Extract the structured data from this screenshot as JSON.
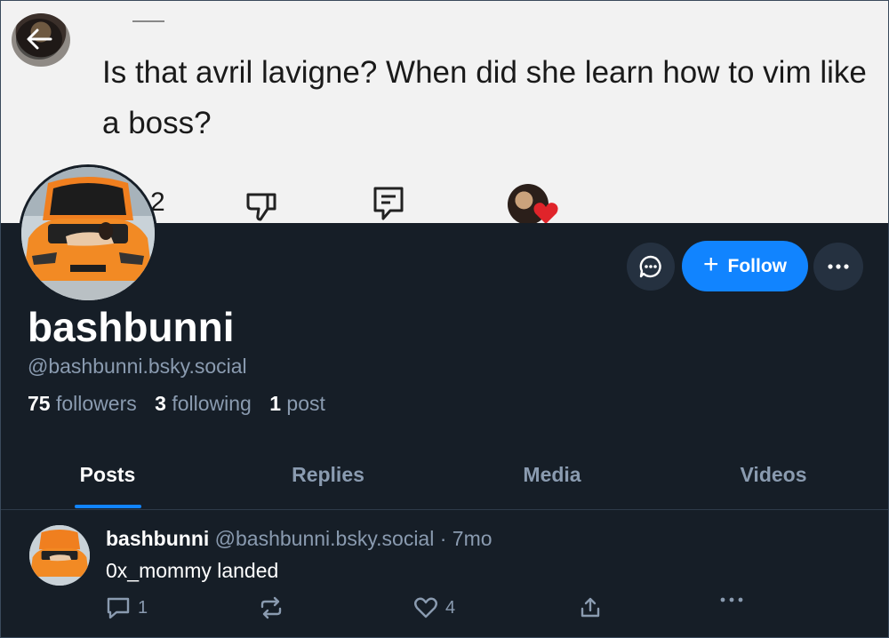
{
  "banner": {
    "quote": "Is that avril lavigne? When did she learn how to vim like a boss?",
    "count": "2"
  },
  "profile": {
    "display_name": "bashbunni",
    "handle": "@bashbunni.bsky.social",
    "followers_count": "75",
    "followers_label": "followers",
    "following_count": "3",
    "following_label": "following",
    "posts_count": "1",
    "posts_label": "post"
  },
  "actions": {
    "follow_label": "Follow"
  },
  "tabs": [
    {
      "label": "Posts"
    },
    {
      "label": "Replies"
    },
    {
      "label": "Media"
    },
    {
      "label": "Videos"
    }
  ],
  "post": {
    "name": "bashbunni",
    "handle": "@bashbunni.bsky.social",
    "separator": "·",
    "time": "7mo",
    "text": "0x_mommy landed",
    "reply_count": "1",
    "like_count": "4"
  },
  "colors": {
    "background": "#161e27",
    "accent": "#1184ff",
    "muted_text": "#8a9bb0"
  }
}
